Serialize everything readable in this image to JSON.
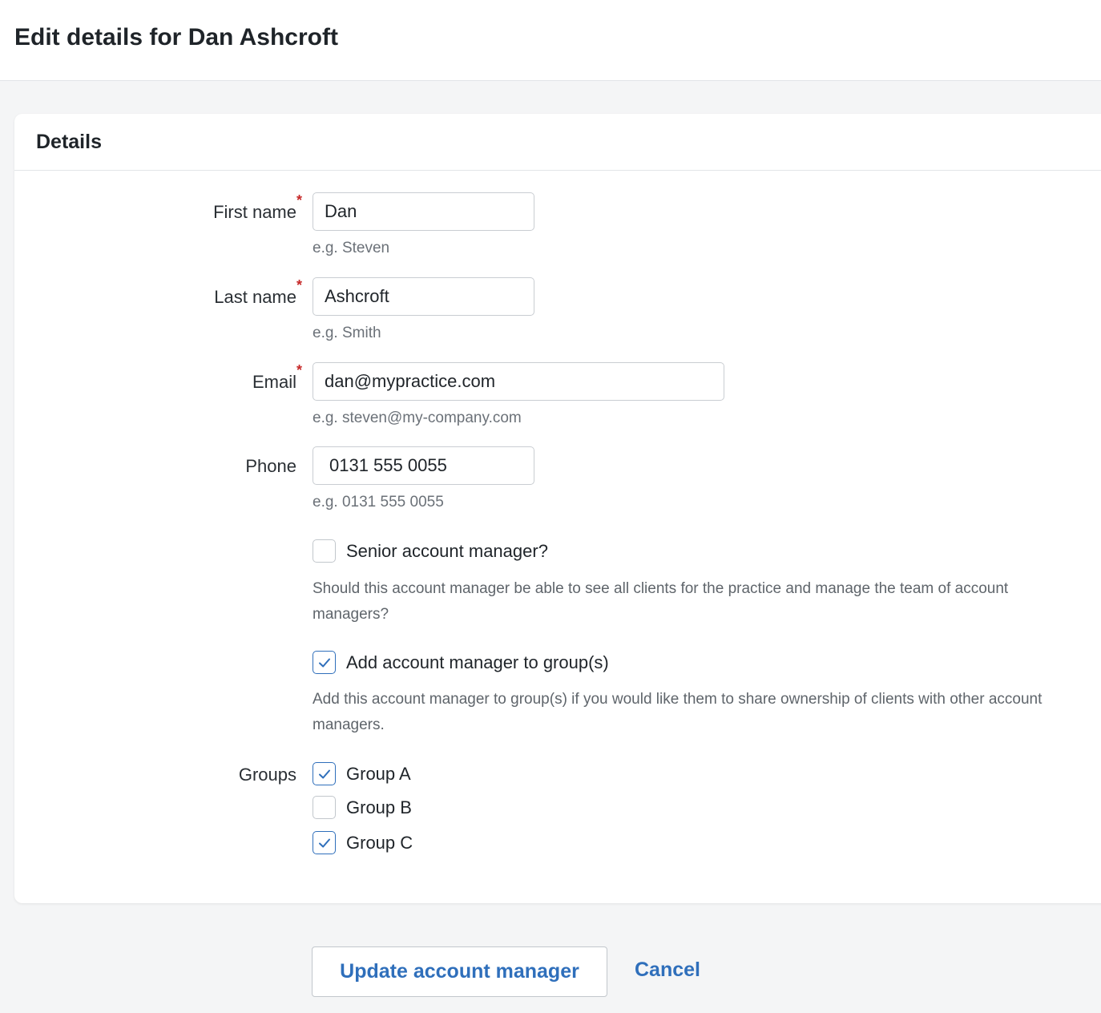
{
  "page": {
    "title": "Edit details for Dan Ashcroft"
  },
  "card": {
    "title": "Details"
  },
  "form": {
    "first_name": {
      "label": "First name",
      "required_mark": "*",
      "value": "Dan",
      "hint": "e.g. Steven"
    },
    "last_name": {
      "label": "Last name",
      "required_mark": "*",
      "value": "Ashcroft",
      "hint": "e.g. Smith"
    },
    "email": {
      "label": "Email",
      "required_mark": "*",
      "value": "dan@mypractice.com",
      "hint": "e.g. steven@my-company.com"
    },
    "phone": {
      "label": "Phone",
      "value": "0131 555 0055",
      "hint": "e.g. 0131 555 0055"
    },
    "senior": {
      "label": "Senior account manager?",
      "checked": false,
      "description": "Should this account manager be able to see all clients for the practice and manage the team of account managers?"
    },
    "add_to_groups": {
      "label": "Add account manager to group(s)",
      "checked": true,
      "description": "Add this account manager to group(s) if you would like them to share ownership of clients with other account managers."
    },
    "groups": {
      "label": "Groups",
      "items": [
        {
          "label": "Group A",
          "checked": true
        },
        {
          "label": "Group B",
          "checked": false
        },
        {
          "label": "Group C",
          "checked": true
        }
      ]
    }
  },
  "actions": {
    "update_label": "Update account manager",
    "cancel_label": "Cancel"
  },
  "colors": {
    "accent": "#2f6fbb",
    "required": "#c62828",
    "background": "#f4f5f6"
  }
}
